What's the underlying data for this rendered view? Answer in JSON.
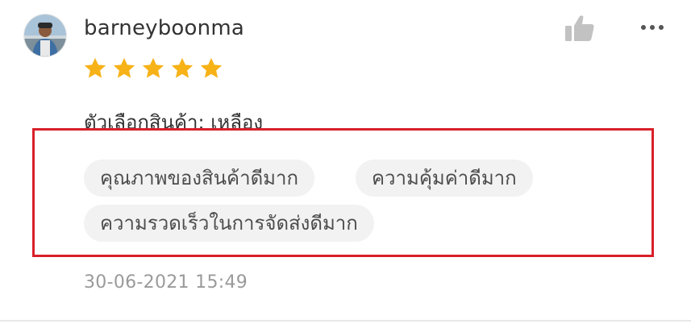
{
  "review": {
    "username": "barneyboonma",
    "rating": 5,
    "rating_max": 5,
    "variant_text": "ตัวเลือกสินค้า: เหลือง",
    "tags": [
      "คุณภาพของสินค้าดีมาก",
      "ความคุ้มค่าดีมาก",
      "ความรวดเร็วในการจัดส่งดีมาก"
    ],
    "timestamp": "30-06-2021 15:49"
  },
  "icons": {
    "like": "thumbs-up-icon",
    "more": "more-horizontal-icon",
    "star": "star-icon"
  },
  "colors": {
    "star": "#f7b217",
    "highlight_border": "#d9202a",
    "tag_background": "#f2f2f2",
    "icon_gray": "#c2c2c2"
  }
}
